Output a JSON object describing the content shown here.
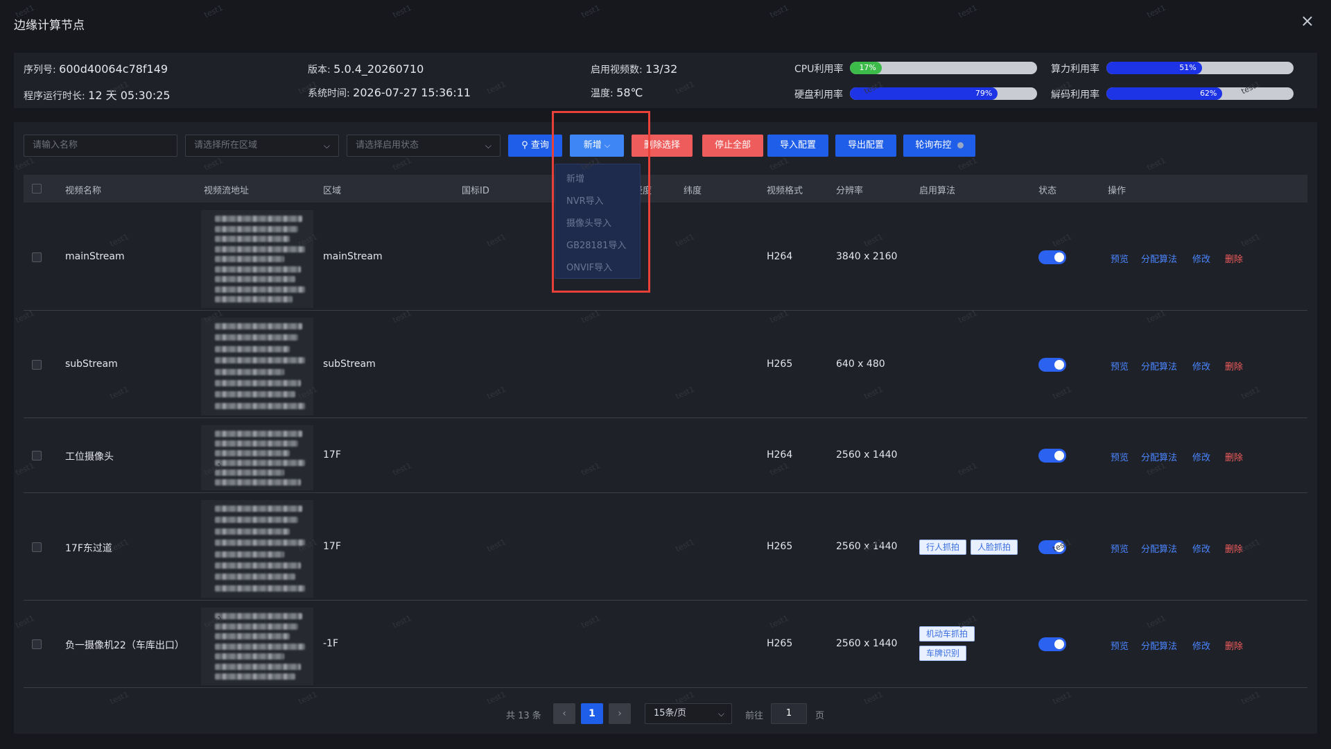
{
  "window": {
    "title": "边缘计算节点",
    "close_icon": "×"
  },
  "info": {
    "serial": {
      "label": "序列号:",
      "value": "600d40064c78f149"
    },
    "uptime": {
      "label": "程序运行时长:",
      "value": "12 天 05:30:25"
    },
    "version": {
      "label": "版本:",
      "value": "5.0.4_20260710"
    },
    "systime": {
      "label": "系统时间:",
      "value": "2026-07-27 15:36:11"
    },
    "streams": {
      "label": "启用视频数:",
      "value": "13/32"
    },
    "temp": {
      "label": "温度:",
      "value": "58℃"
    },
    "meters": [
      {
        "label": "CPU利用率",
        "value": 0.17,
        "text": "17%",
        "color": "#3dbb4a"
      },
      {
        "label": "算力利用率",
        "value": 0.51,
        "text": "51%",
        "color": "#1d33e6"
      },
      {
        "label": "硬盘利用率",
        "value": 0.79,
        "text": "79%",
        "color": "#1d33e6"
      },
      {
        "label": "解码利用率",
        "value": 0.62,
        "text": "62%",
        "color": "#1d33e6"
      }
    ]
  },
  "filters": {
    "name_placeholder": "请输入名称",
    "region_placeholder": "请选择所在区域",
    "status_placeholder": "请选择启用状态"
  },
  "toolbar": {
    "query": "查询",
    "add": "新增",
    "delete_selected": "删除选择",
    "stop_all": "停止全部",
    "import_config": "导入配置",
    "export_config": "导出配置",
    "patrol": "轮询布控"
  },
  "add_menu": {
    "items": [
      "新增",
      "NVR导入",
      "摄像头导入",
      "GB28181导入",
      "ONVIF导入"
    ]
  },
  "table": {
    "columns": [
      "视频名称",
      "视频流地址",
      "区域",
      "国标ID",
      "经度",
      "纬度",
      "视频格式",
      "分辨率",
      "启用算法",
      "状态",
      "操作"
    ],
    "actions": {
      "preview": "预览",
      "assign": "分配算法",
      "edit": "修改",
      "delete": "删除"
    },
    "rows": [
      {
        "name": "mainStream",
        "region": "mainStream",
        "format": "H264",
        "resolution": "3840 x 2160",
        "algorithms": [],
        "enabled": true
      },
      {
        "name": "subStream",
        "region": "subStream",
        "format": "H265",
        "resolution": "640 x 480",
        "algorithms": [],
        "enabled": true
      },
      {
        "name": "工位摄像头",
        "region": "17F",
        "format": "H264",
        "resolution": "2560 x 1440",
        "algorithms": [],
        "enabled": true
      },
      {
        "name": "17F东过道",
        "region": "17F",
        "format": "H265",
        "resolution": "2560 x 1440",
        "algorithms": [
          "行人抓拍",
          "人脸抓拍"
        ],
        "enabled": true
      },
      {
        "name": "负一摄像机22（车库出口）",
        "region": "-1F",
        "format": "H265",
        "resolution": "2560 x 1440",
        "algorithms": [
          "机动车抓拍",
          "车牌识别"
        ],
        "enabled": true
      }
    ]
  },
  "pagination": {
    "total": "共 13 条",
    "prev": "‹",
    "next": "›",
    "current": "1",
    "page_size": "15条/页",
    "goto_label": "前往",
    "goto_value": "1",
    "page_unit": "页"
  },
  "watermark": "test1"
}
